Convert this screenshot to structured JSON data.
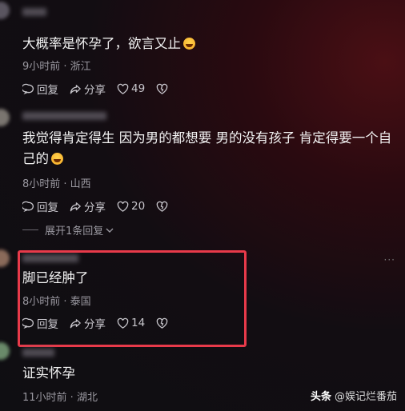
{
  "comments": [
    {
      "text": "大概率是怀孕了，欲言又止",
      "meta": "9小时前 · 浙江",
      "reply": "回复",
      "share": "分享",
      "likes": "49"
    },
    {
      "text": "我觉得肯定得生 因为男的都想要 男的没有孩子 肯定得要一个自己的",
      "meta": "8小时前 · 山西",
      "reply": "回复",
      "share": "分享",
      "likes": "20",
      "expand_replies": "展开1条回复"
    },
    {
      "text": "脚已经肿了",
      "meta": "8小时前 · 泰国",
      "reply": "回复",
      "share": "分享",
      "likes": "14"
    },
    {
      "text": "证实怀孕",
      "meta": "11小时前 · 湖北"
    }
  ],
  "watermark": {
    "brand": "头条",
    "handle": "@娱记烂番茄"
  },
  "colors": {
    "highlight_border": "#e83a4a",
    "background": "#0f0e12"
  }
}
